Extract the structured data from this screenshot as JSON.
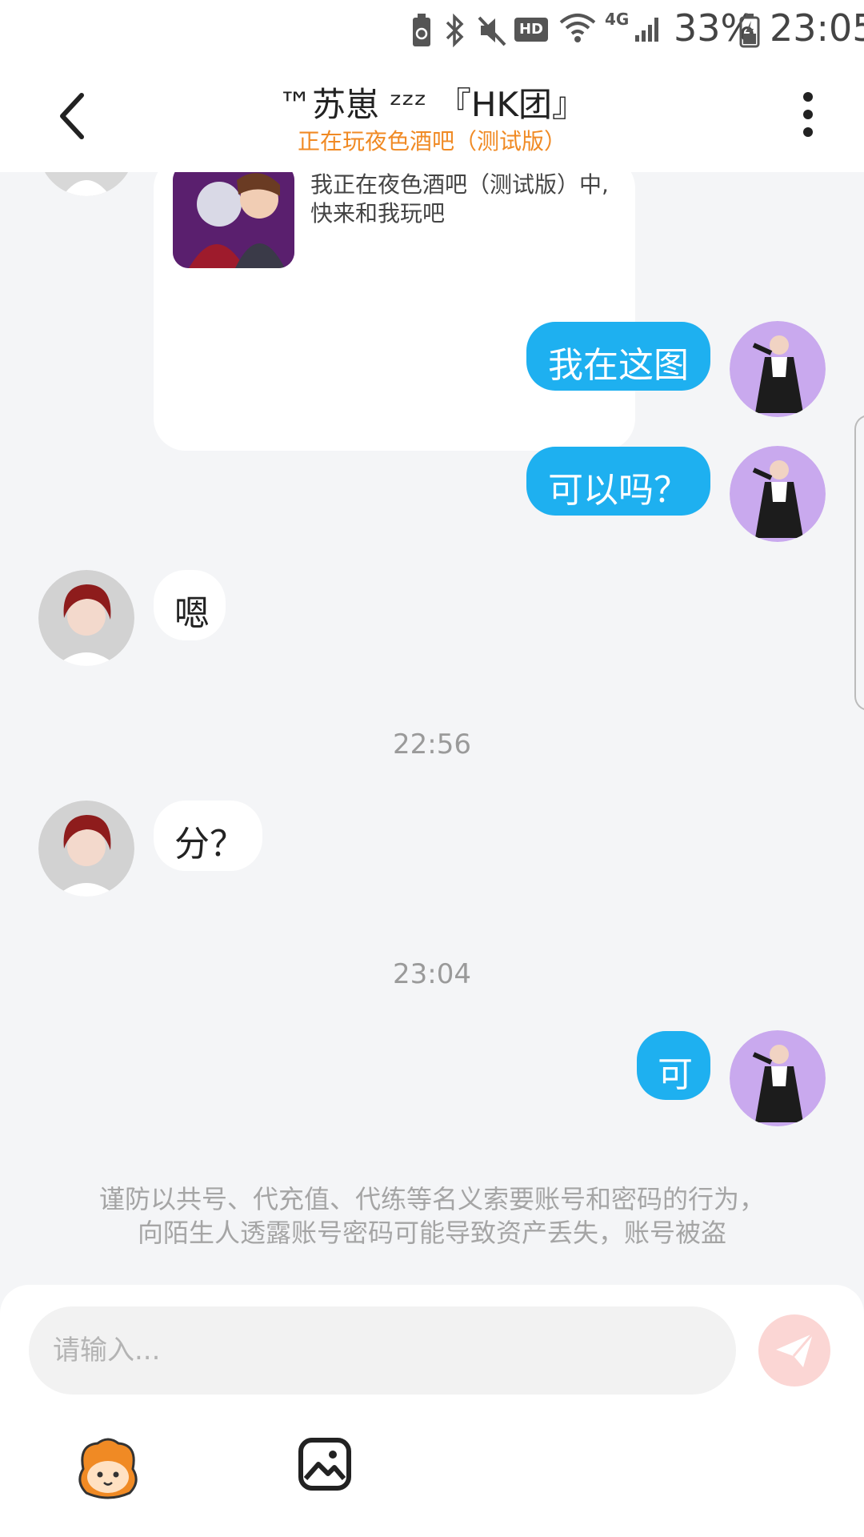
{
  "status_bar": {
    "battery_percent": "33%",
    "time": "23:05",
    "hd_label": "HD",
    "network_label": "4G",
    "icons": [
      "battery-saver-icon",
      "bluetooth-icon",
      "mute-icon",
      "hd-icon",
      "wifi-icon",
      "signal-icon",
      "battery-charging-icon"
    ]
  },
  "header": {
    "title": "™苏崽 ᶻᶻᶻ 『HK团』",
    "subtitle": "正在玩夜色酒吧（测试版）",
    "back_icon": "chevron-left-icon",
    "more_icon": "more-vertical-icon"
  },
  "messages": {
    "card": {
      "text": "我正在夜色酒吧（测试版）中,快来和我玩吧"
    },
    "m1": {
      "side": "right",
      "text": "我在这图"
    },
    "m2": {
      "side": "right",
      "text": "可以吗？"
    },
    "m3": {
      "side": "left",
      "text": "嗯"
    },
    "t1": {
      "time": "22:56"
    },
    "m4": {
      "side": "left",
      "text": "分？"
    },
    "t2": {
      "time": "23:04"
    },
    "m5": {
      "side": "right",
      "text": "可"
    }
  },
  "warning": {
    "line1": "谨防以共号、代充值、代练等名义索要账号和密码的行为，",
    "line2": "向陌生人透露账号密码可能导致资产丢失，账号被盗"
  },
  "input_bar": {
    "placeholder": "请输入...",
    "send_icon": "send-icon",
    "emoji_icon": "emoji-mascot-icon",
    "image_icon": "image-icon"
  },
  "colors": {
    "accent_blue": "#1eb0f0",
    "subtitle_orange": "#f08a24",
    "send_disabled": "#fbd6d4",
    "background": "#f4f5f7"
  }
}
